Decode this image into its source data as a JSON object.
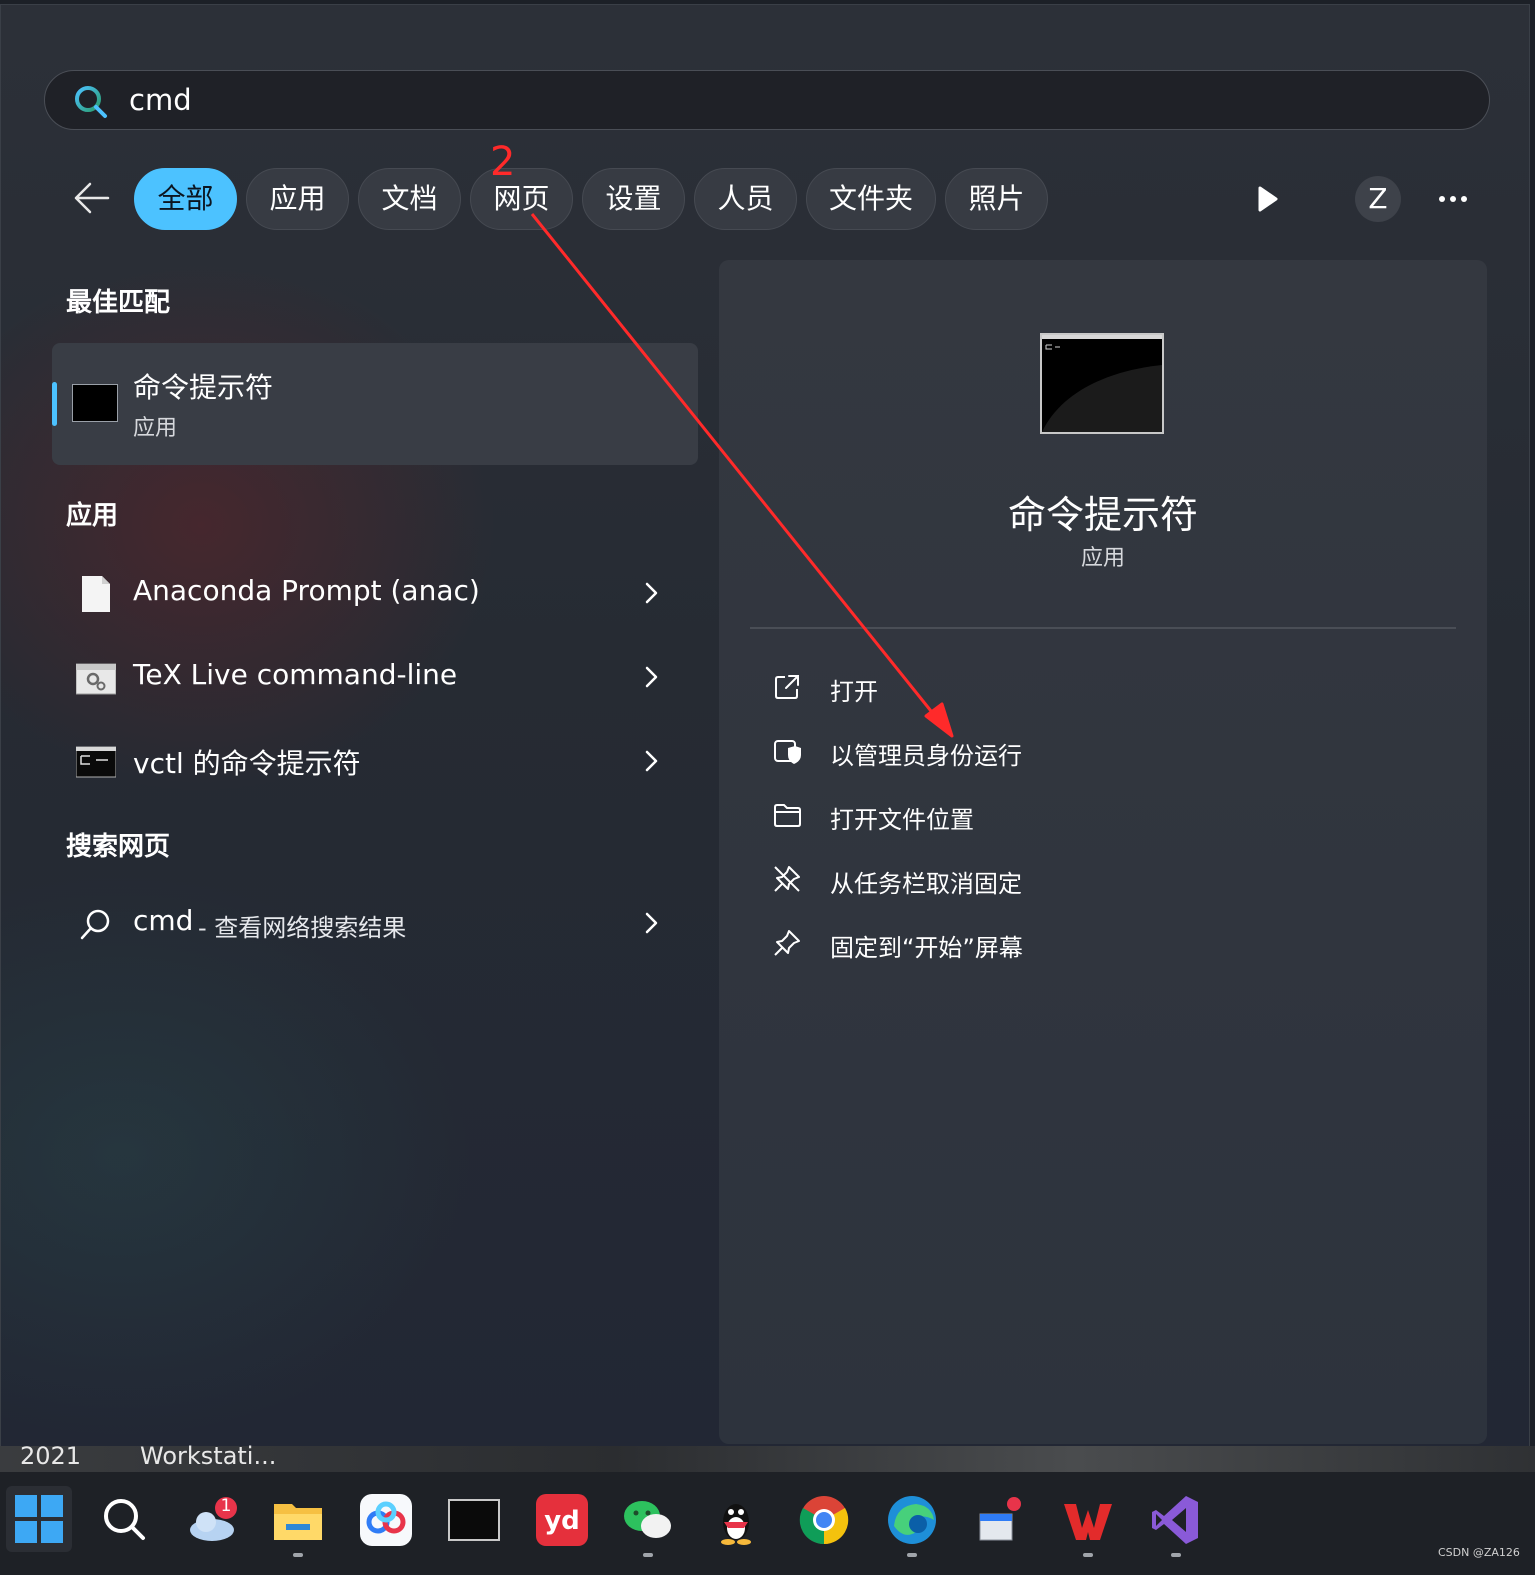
{
  "search": {
    "query": "cmd"
  },
  "annotation": {
    "step_number": "2"
  },
  "filters": [
    "全部",
    "应用",
    "文档",
    "网页",
    "设置",
    "人员",
    "文件夹",
    "照片"
  ],
  "profile": {
    "initial": "Z"
  },
  "best_match": {
    "section_title": "最佳匹配",
    "name": "命令提示符",
    "type": "应用"
  },
  "apps": {
    "section_title": "应用",
    "items": [
      {
        "label": "Anaconda Prompt (anac)",
        "icon": "document-icon"
      },
      {
        "label": "TeX Live command-line",
        "icon": "tex-settings-icon"
      },
      {
        "label": "vctl 的命令提示符",
        "icon": "console-icon"
      }
    ]
  },
  "web": {
    "section_title": "搜索网页",
    "query": "cmd",
    "suffix": "- 查看网络搜索结果"
  },
  "detail": {
    "name": "命令提示符",
    "type": "应用",
    "actions": [
      {
        "label": "打开",
        "icon": "open-external-icon"
      },
      {
        "label": "以管理员身份运行",
        "icon": "shield-admin-icon"
      },
      {
        "label": "打开文件位置",
        "icon": "folder-icon"
      },
      {
        "label": "从任务栏取消固定",
        "icon": "unpin-icon"
      },
      {
        "label": "固定到“开始”屏幕",
        "icon": "pin-icon"
      }
    ]
  },
  "background": {
    "left_text": "2021",
    "right_text": "Workstati..."
  },
  "taskbar": {
    "items": [
      "windows-start-icon",
      "search-icon",
      "weather-icon",
      "file-explorer-icon",
      "baidu-netdisk-icon",
      "terminal-icon",
      "youdao-icon",
      "wechat-icon",
      "qq-icon",
      "chrome-icon",
      "edge-icon",
      "app-notification-icon",
      "wps-icon",
      "visual-studio-icon"
    ],
    "weather_badge": "1"
  },
  "watermark": "CSDN @ZA126",
  "colors": {
    "accent": "#4cc2ff",
    "annotation": "#ff2a2a"
  }
}
